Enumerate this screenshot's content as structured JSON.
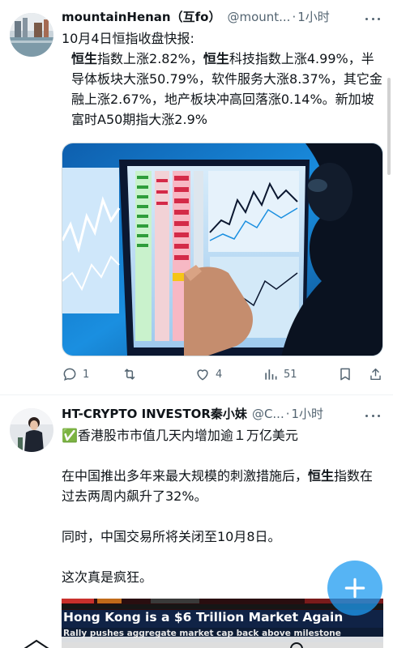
{
  "colors": {
    "text": "#0f1419",
    "muted": "#536471",
    "accent": "#1d9bf0",
    "divider": "#eff3f4"
  },
  "post1": {
    "author": "mountainHenan（互fo）",
    "handle": "@mount...",
    "dot": "·",
    "time": "1小时",
    "line1": "10月4日恒指收盘快报:",
    "para_bold1": "恒生",
    "para_part1": "指数上涨2.82%，",
    "para_bold2": "恒生",
    "para_part2": "科技指数上涨4.99%，半导体板块大涨50.79%，软件服务大涨8.37%，其它金融上涨2.67%，地产板块冲高回落涨0.14%。新加坡富时A50期指大涨2.9%",
    "media_icon": "stock-trading-screen-photo",
    "actions": {
      "reply_count": "1",
      "retweet_count": "",
      "like_count": "4",
      "views_count": "51"
    }
  },
  "post2": {
    "author": "HT-CRYPTO INVESTOR秦小妹",
    "handle": "@C...",
    "dot": "·",
    "time": "1小时",
    "line1_emoji": "✅",
    "line1": "香港股市市值几天内增加逾１万亿美元",
    "para2_part1": "在中国推出多年来最大规模的刺激措施后，",
    "para2_bold": "恒生",
    "para2_part2": "指数在过去两周内飙升了32%。",
    "para3": "同时，中国交易所将关闭至10月8日。",
    "para4": "这次真是疯狂。",
    "news_headline": "Hong Kong is a $6 Trillion Market Again",
    "news_sub": "Rally pushes aggregate market cap back above milestone"
  }
}
